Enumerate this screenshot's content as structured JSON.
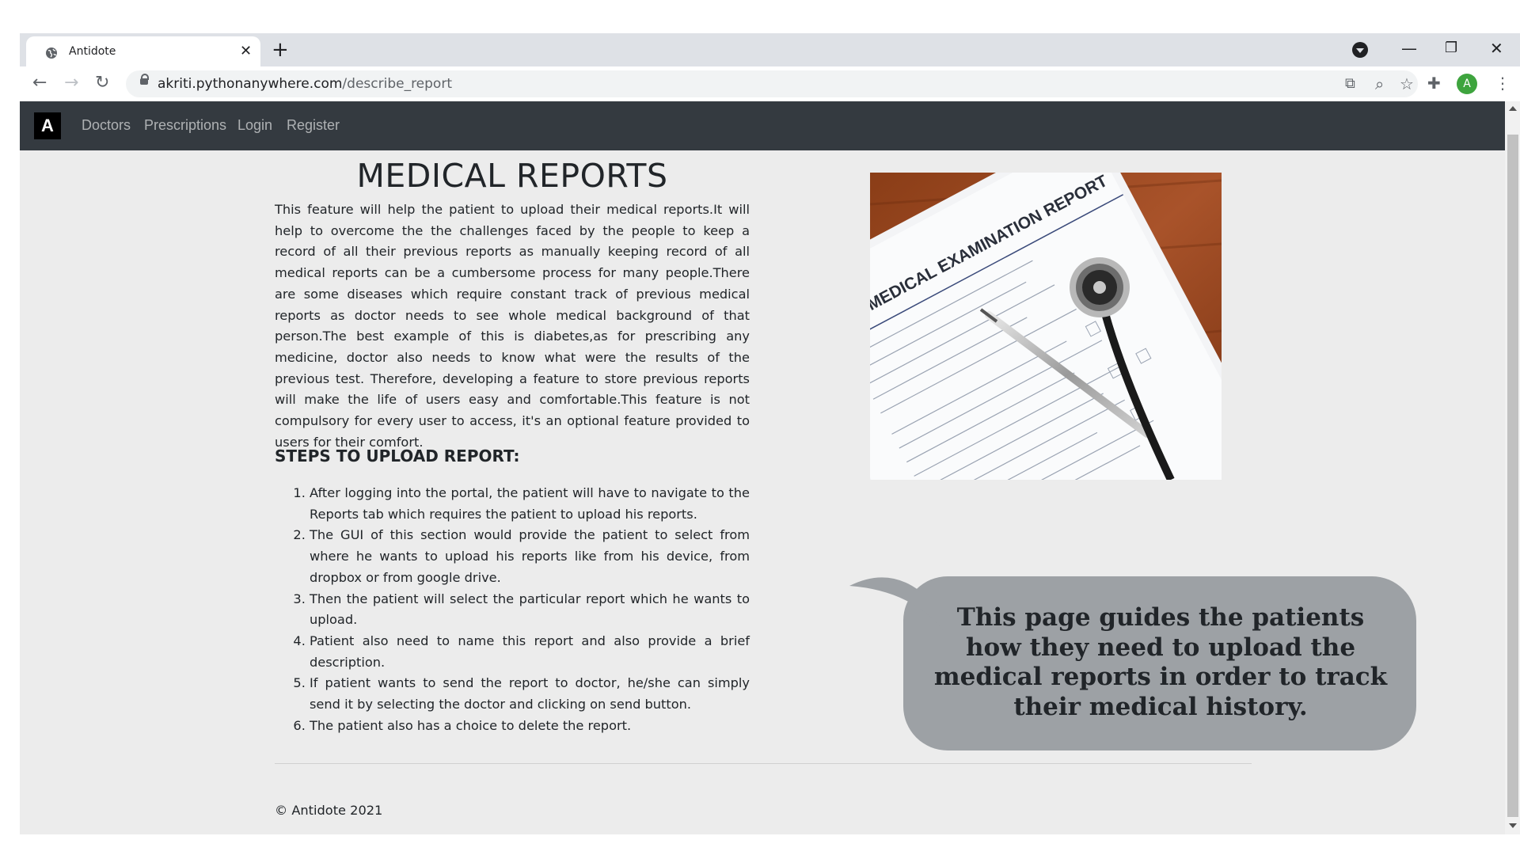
{
  "browser": {
    "tab_title": "Antidote",
    "tab_close": "✕",
    "new_tab": "+",
    "url_host": "akriti.pythonanywhere.com",
    "url_path": "/describe_report",
    "icons": [
      "globe-icon",
      "tab-search-icon",
      "back-icon",
      "forward-icon",
      "reload-icon",
      "lock-icon",
      "translate-icon",
      "zoom-icon",
      "bookmark-star-icon",
      "extensions-icon",
      "profile-icon",
      "menu-icon"
    ],
    "profile_initial": "A",
    "window_controls": {
      "minimize": "—",
      "restore": "❐",
      "close": "✕"
    },
    "nav": {
      "back": "←",
      "forward": "→",
      "reload": "↻"
    },
    "toolbar_glyphs": {
      "translate": "⧉",
      "zoom": "⌕",
      "star": "☆",
      "extensions": "✚",
      "menu": "⋮"
    }
  },
  "site": {
    "brand": "A",
    "nav_links": [
      "Doctors",
      "Prescriptions",
      "Login",
      "Register"
    ]
  },
  "main": {
    "title": "MEDICAL REPORTS",
    "intro": "This feature will help the patient to upload their medical reports.It will help to overcome the the challenges faced by the people to keep a record of all their previous reports as manually keeping record of all medical reports can be a cumbersome process for many people.There are some diseases which require constant track of previous medical reports as doctor needs to see whole medical background of that person.The best example of this is diabetes,as for prescribing any medicine, doctor also needs to know what were the results of the previous test. Therefore, developing a feature to store previous reports will make the life of users easy and comfortable.This feature is not compulsory for every user to access, it's an optional feature provided to users for their comfort.",
    "steps_heading": "STEPS TO UPLOAD REPORT:",
    "steps": [
      "After logging into the portal, the patient will have to navigate to the Reports tab which requires the patient to upload his reports.",
      "The GUI of this section would provide the patient to select from where he wants to upload his reports like from his device, from dropbox or from google drive.",
      "Then the patient will select the particular report which he wants to upload.",
      "Patient also need to name this report and also provide a brief description.",
      "If patient wants to send the report to doctor, he/she can simply send it by selecting the doctor and clicking on send button.",
      "The patient also has a choice to delete the report."
    ],
    "image_text": "MEDICAL EXAMINATION REPORT",
    "bubble_text": "This page guides the patients how they need to upload the medical reports in order to track their medical history."
  },
  "footer": {
    "copyright": "© Antidote 2021"
  },
  "colors": {
    "navbar": "#343a40",
    "page_bg": "#ececec",
    "bubble": "#9da1a5",
    "tabstrip": "#dee1e6"
  }
}
